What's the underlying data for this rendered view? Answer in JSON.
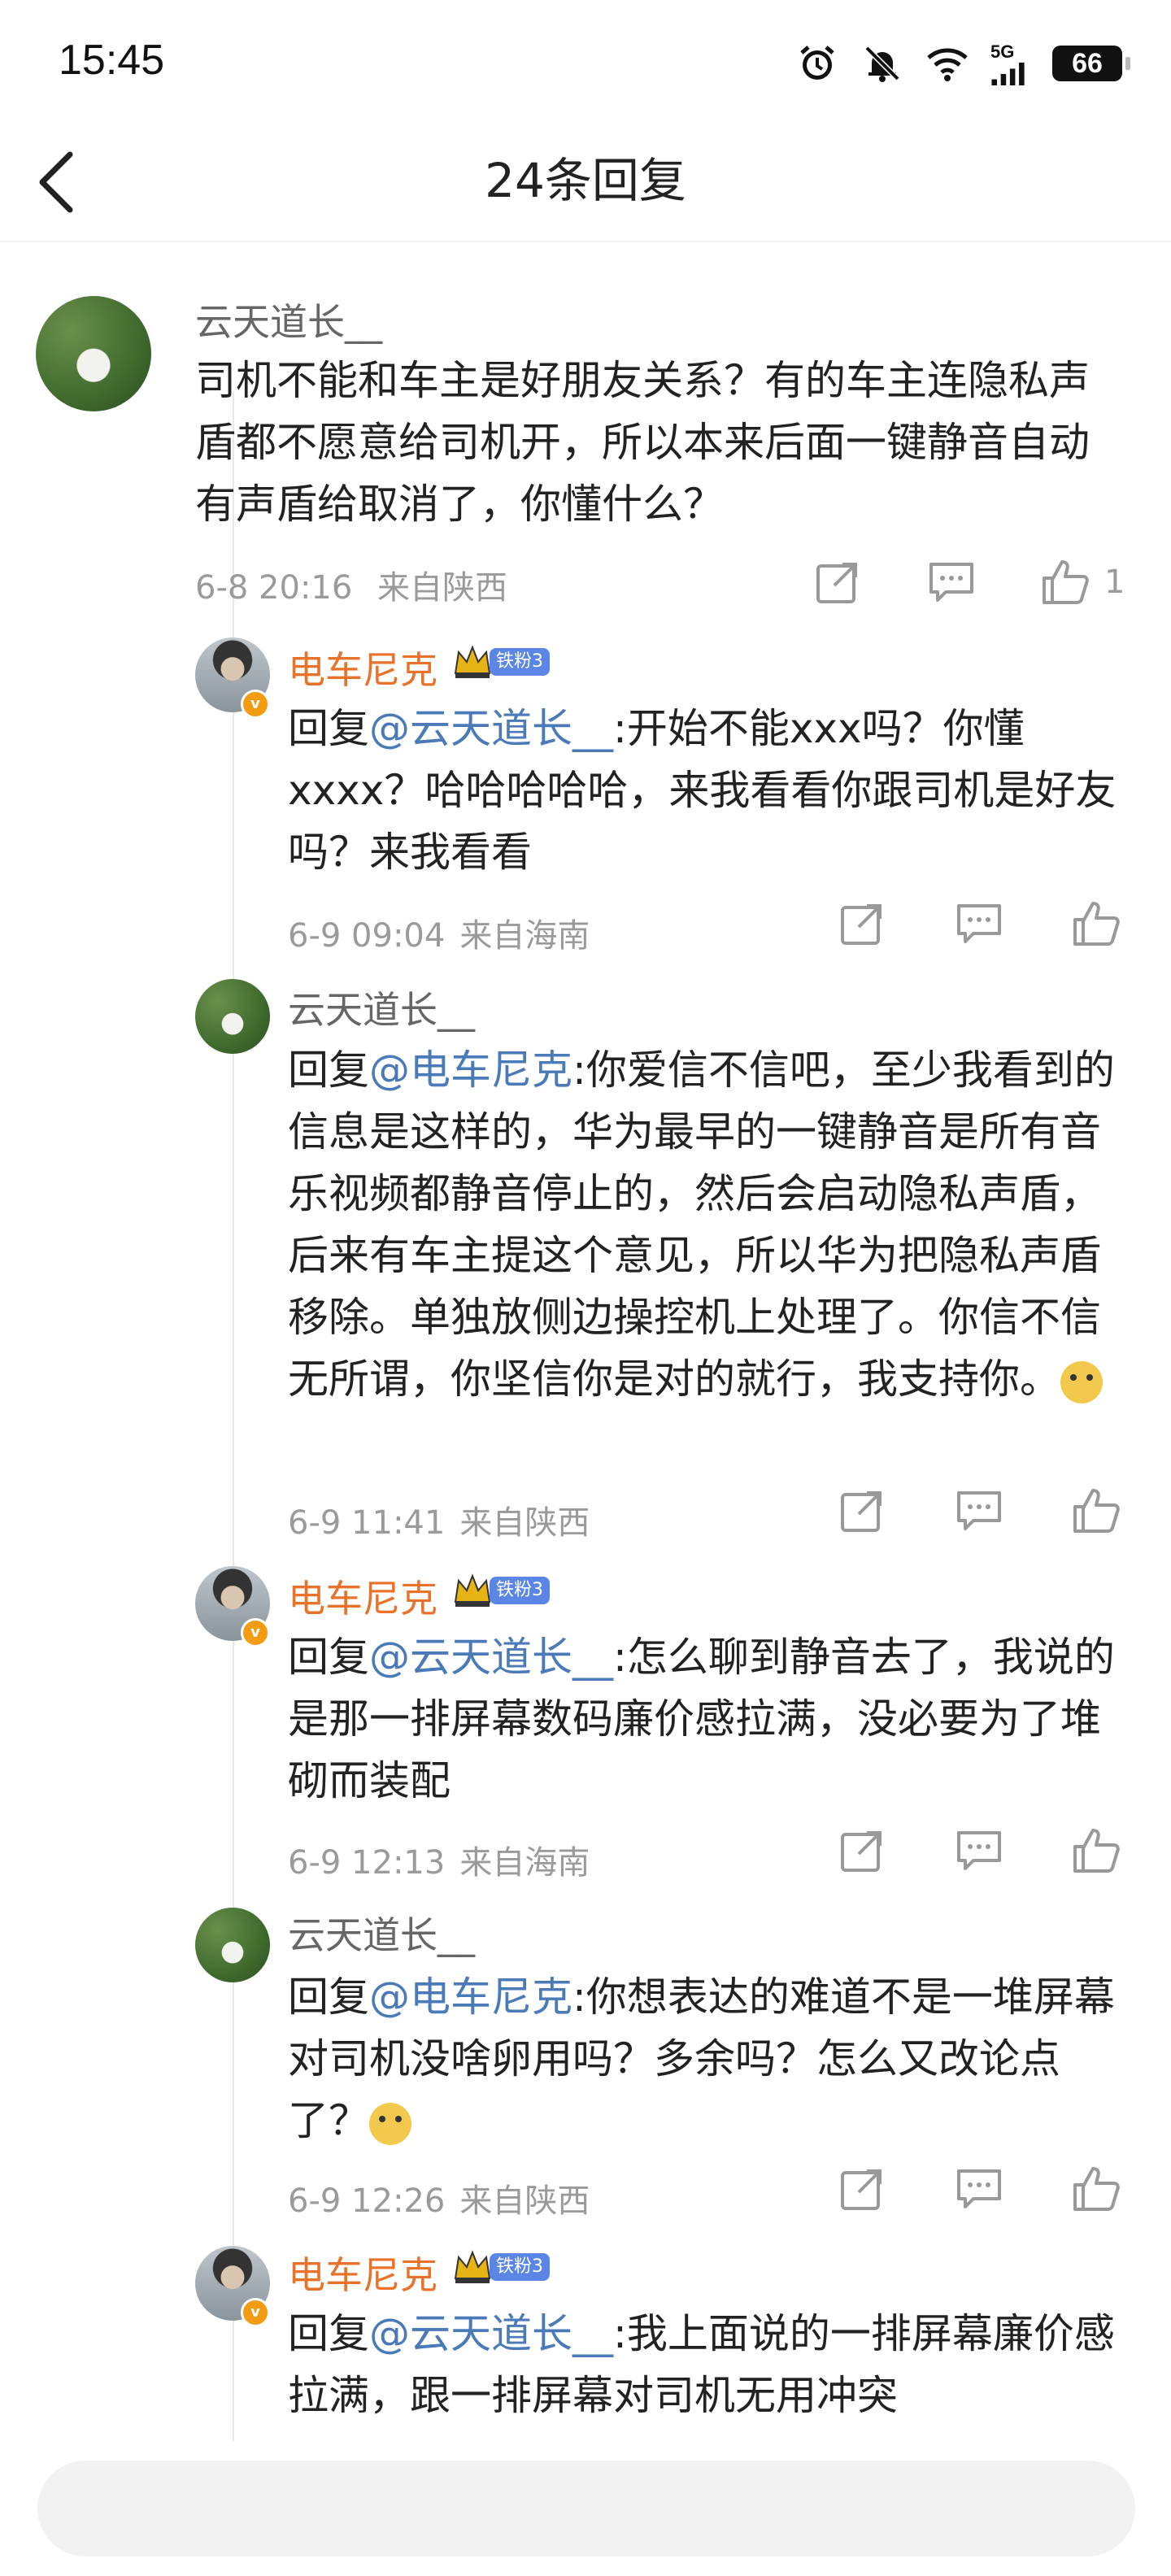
{
  "status_bar": {
    "time": "15:45",
    "network": "5G",
    "battery": "66"
  },
  "header": {
    "title": "24条回复"
  },
  "main_comment": {
    "author": "云天道长__",
    "text": "司机不能和车主是好朋友关系？有的车主连隐私声盾都不愿意给司机开，所以本来后面一键静音自动有声盾给取消了，你懂什么？",
    "time": "6-8 20:16",
    "location": "来自陕西",
    "likes": "1"
  },
  "replies": [
    {
      "author": "电车尼克",
      "fan_badge": "铁粉3",
      "prefix": "回复",
      "mention": "@云天道长__",
      "text": ":开始不能xxx吗？你懂xxxx？哈哈哈哈哈，来我看看你跟司机是好友吗？来我看看",
      "time": "6-9 09:04",
      "location": "来自海南"
    },
    {
      "author": "云天道长__",
      "prefix": "回复",
      "mention": "@电车尼克",
      "text": ":你爱信不信吧，至少我看到的信息是这样的，华为最早的一键静音是所有音乐视频都静音停止的，然后会启动隐私声盾，后来有车主提这个意见，所以华为把隐私声盾移除。单独放侧边操控机上处理了。你信不信无所谓，你坚信你是对的就行，我支持你。",
      "time": "6-9 11:41",
      "location": "来自陕西"
    },
    {
      "author": "电车尼克",
      "fan_badge": "铁粉3",
      "prefix": "回复",
      "mention": "@云天道长__",
      "text": ":怎么聊到静音去了，我说的是那一排屏幕数码廉价感拉满，没必要为了堆砌而装配",
      "time": "6-9 12:13",
      "location": "来自海南"
    },
    {
      "author": "云天道长__",
      "prefix": "回复",
      "mention": "@电车尼克",
      "text": ":你想表达的难道不是一堆屏幕对司机没啥卵用吗？多余吗？怎么又改论点了？",
      "time": "6-9 12:26",
      "location": "来自陕西"
    },
    {
      "author": "电车尼克",
      "fan_badge": "铁粉3",
      "prefix": "回复",
      "mention": "@云天道长__",
      "text": ":我上面说的一排屏幕廉价感拉满，跟一排屏幕对司机无用冲突",
      "time": "",
      "location": ""
    }
  ],
  "bottom_bar": {
    "placeholder": ""
  },
  "colors": {
    "mention": "#4a7ab8",
    "author_highlight": "#e8722a",
    "meta": "#9a9a9a"
  }
}
